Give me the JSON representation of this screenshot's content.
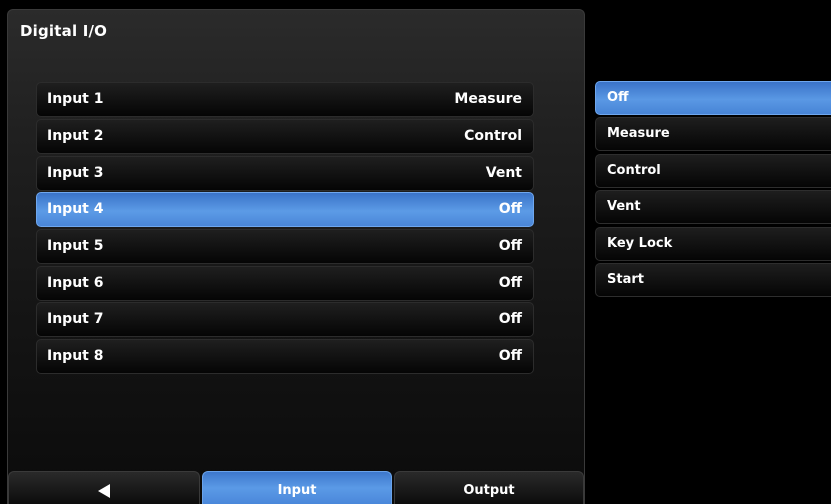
{
  "title": "Digital I/O",
  "inputs": [
    {
      "label": "Input 1",
      "value": "Measure",
      "selected": false
    },
    {
      "label": "Input 2",
      "value": "Control",
      "selected": false
    },
    {
      "label": "Input 3",
      "value": "Vent",
      "selected": false
    },
    {
      "label": "Input 4",
      "value": "Off",
      "selected": true
    },
    {
      "label": "Input 5",
      "value": "Off",
      "selected": false
    },
    {
      "label": "Input 6",
      "value": "Off",
      "selected": false
    },
    {
      "label": "Input 7",
      "value": "Off",
      "selected": false
    },
    {
      "label": "Input 8",
      "value": "Off",
      "selected": false
    }
  ],
  "options": [
    {
      "label": "Off",
      "selected": true
    },
    {
      "label": "Measure",
      "selected": false
    },
    {
      "label": "Control",
      "selected": false
    },
    {
      "label": "Vent",
      "selected": false
    },
    {
      "label": "Key Lock",
      "selected": false
    },
    {
      "label": "Start",
      "selected": false
    }
  ],
  "tabs": {
    "back_icon": "back-arrow-icon",
    "input_label": "Input",
    "output_label": "Output",
    "active": "Input"
  },
  "colors": {
    "selection": "#4a86d8",
    "background": "#000000"
  }
}
